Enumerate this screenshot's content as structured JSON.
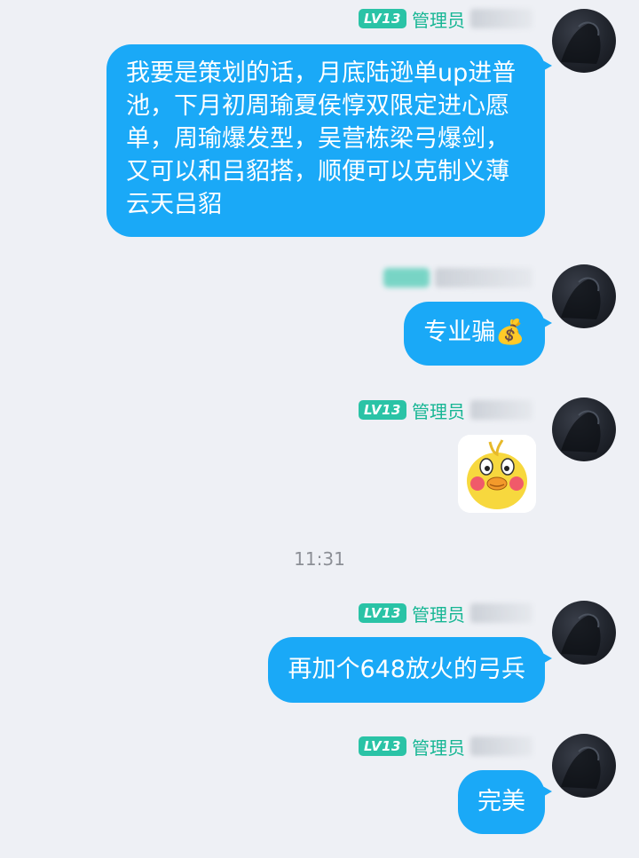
{
  "messages": [
    {
      "level": "LV13",
      "role": "管理员",
      "text": "我要是策划的话，月底陆逊单up进普池，下月初周瑜夏侯惇双限定进心愿单，周瑜爆发型，吴营栋梁弓爆剑，又可以和吕貂搭，顺便可以克制义薄云天吕貂"
    },
    {
      "text": "专业骗",
      "emoji": "💰"
    },
    {
      "level": "LV13",
      "role": "管理员",
      "sticker": "yellow-duck-sticker"
    },
    {
      "level": "LV13",
      "role": "管理员",
      "text": "再加个648放火的弓兵"
    },
    {
      "level": "LV13",
      "role": "管理员",
      "text": "完美"
    }
  ],
  "timestamp": "11:31",
  "colors": {
    "bubble": "#1aa9f7",
    "badge": "#2ac3a6",
    "role_text": "#17b694",
    "background": "#eef0f5"
  }
}
